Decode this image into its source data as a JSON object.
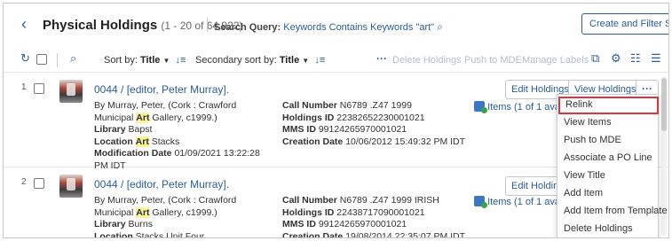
{
  "header": {
    "title": "Physical Holdings",
    "count": "(1 - 20 of 64,922)",
    "search_label": "Search Query:",
    "search_value": "Keywords Contains Keywords \"art\"",
    "create_button": "Create and Filter Set"
  },
  "toolbar": {
    "sort_label": "Sort by:",
    "sort_value": "Title",
    "secondary_sort_label": "Secondary sort by:",
    "secondary_sort_value": "Title",
    "actions": [
      "Delete Holdings",
      "Push to MDE",
      "Manage Labels"
    ]
  },
  "records": [
    {
      "number": "1",
      "title": "0044 / [editor, Peter Murray].",
      "by_pre": "By Murray, Peter, (Cork : Crawford Municipal ",
      "by_hl": "Art",
      "by_post": " Gallery, c1999.)",
      "library_label": "Library",
      "library": "Bapst",
      "location_label": "Location",
      "location_hl": "Art",
      "location_post": " Stacks",
      "moddate_label": "Modification Date",
      "moddate": "01/09/2021 13:22:28 PM IDT",
      "callnum_label": "Call Number",
      "callnum": "N6789 .Z47 1999",
      "hid_label": "Holdings ID",
      "hid": "22382652230001021",
      "mms_label": "MMS ID",
      "mms": "99124265970001021",
      "created_label": "Creation Date",
      "created": "10/06/2012 15:49:32 PM IDT",
      "items": "Items (1 of 1 available)",
      "edit_button": "Edit Holdings",
      "view_button": "View Holdings",
      "more_button": "···"
    },
    {
      "number": "2",
      "title": "0044 / [editor, Peter Murray].",
      "by_pre": "By Murray, Peter, (Cork : Crawford Municipal ",
      "by_hl": "Art",
      "by_post": " Gallery, c1999.)",
      "library_label": "Library",
      "library": "Burns",
      "location_label": "Location",
      "location": "Stacks Unit Four",
      "callnum_label": "Call Number",
      "callnum": "N6789 .Z47 1999 IRISH",
      "hid_label": "Holdings ID",
      "hid": "22438717090001021",
      "mms_label": "MMS ID",
      "mms": "99124265970001021",
      "created_label": "Creation Date",
      "created": "19/08/2014 22:35:07 PM IDT",
      "items": "Items (1 of 1 available)",
      "edit_button": "Edit Holdings"
    }
  ],
  "menu": {
    "items": [
      "Relink",
      "View Items",
      "Push to MDE",
      "Associate a PO Line",
      "View Title",
      "Add Item",
      "Add Item from Template",
      "Delete Holdings"
    ]
  },
  "icons": {
    "back": "chevron-left-icon",
    "search_refine": "search-refine-icon",
    "refresh": "refresh-icon",
    "search": "search-icon",
    "sort": "sort-icon",
    "more": "more-icon",
    "export": "export-icon",
    "settings": "gear-icon",
    "columns": "columns-icon",
    "list": "list-icon"
  },
  "colors": {
    "link": "#2b5c9e",
    "highlight": "#fbf39a",
    "selected_border": "#d9363e",
    "disabled": "#b5bec9"
  }
}
